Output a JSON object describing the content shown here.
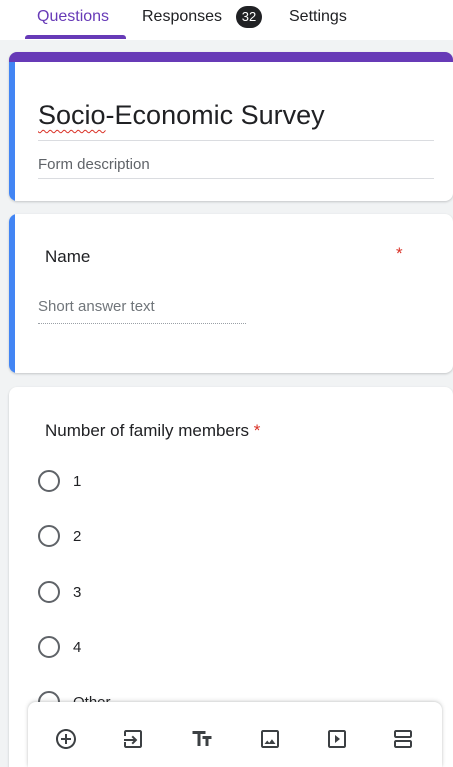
{
  "tabs": {
    "questions": "Questions",
    "responses": "Responses",
    "responses_count": "32",
    "settings": "Settings"
  },
  "form": {
    "title_prefix": "Socio",
    "title_rest": "-Economic Survey",
    "description_placeholder": "Form description"
  },
  "questions": {
    "q1": {
      "title": "Name",
      "required_mark": "*",
      "answer_placeholder": "Short answer text"
    },
    "q2": {
      "title": "Number of family members",
      "required_mark": "*",
      "options": [
        "1",
        "2",
        "3",
        "4",
        "Other..."
      ]
    }
  },
  "toolbar": {
    "icons": [
      "add-question-icon",
      "import-questions-icon",
      "add-title-icon",
      "add-image-icon",
      "add-video-icon",
      "add-section-icon"
    ]
  },
  "colors": {
    "accent": "#673ab7",
    "focus_bar": "#4285f4",
    "required": "#d93025"
  }
}
